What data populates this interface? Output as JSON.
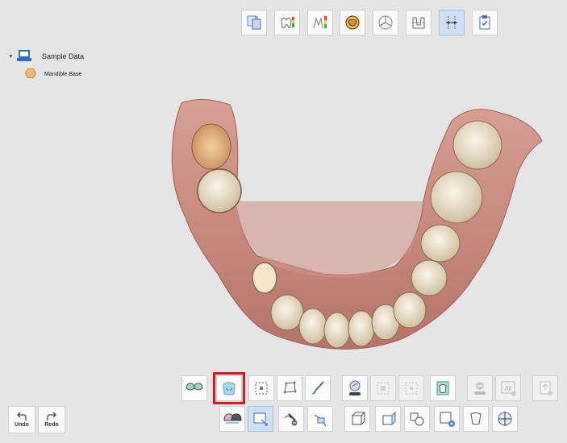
{
  "tree": {
    "root_label": "Sample Data",
    "child_label": "Mandible Base"
  },
  "top_toolbar": [
    "align-icon",
    "shade-icon",
    "color-map-icon",
    "occlusion-icon",
    "axis-icon",
    "cross-section-icon",
    "measure-icon",
    "checklist-icon"
  ],
  "edit_toolbar": {
    "undo_label": "Undo",
    "redo_label": "Redo"
  },
  "colors": {
    "background": "#e5e5e5",
    "active": "#cfe0f3",
    "highlight": "#e2141b",
    "gum": "#c98a80",
    "tooth": "#efe6d2"
  }
}
